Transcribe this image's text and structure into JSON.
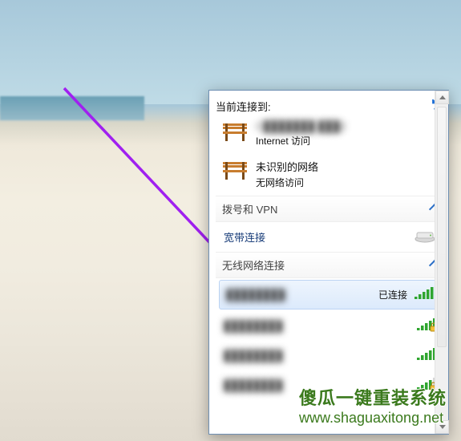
{
  "header": {
    "title": "当前连接到:"
  },
  "connections": [
    {
      "name": "C███████ ███2",
      "sub": "Internet 访问",
      "blurred": true
    },
    {
      "name": "未识别的网络",
      "sub": "无网络访问",
      "blurred": false
    }
  ],
  "sections": {
    "dialup": {
      "label": "拨号和 VPN",
      "items": [
        {
          "label": "宽带连接"
        }
      ]
    },
    "wireless": {
      "label": "无线网络连接",
      "items": [
        {
          "label": "████████",
          "status": "已连接",
          "bars": 5,
          "secure": false,
          "selected": true
        },
        {
          "label": "████████",
          "status": "",
          "bars": 5,
          "secure": true,
          "selected": false
        },
        {
          "label": "████████",
          "status": "",
          "bars": 5,
          "secure": false,
          "selected": false
        },
        {
          "label": "████████",
          "status": "",
          "bars": 4,
          "secure": true,
          "selected": false
        }
      ]
    }
  },
  "watermark": {
    "title": "傻瓜一键重装系统",
    "url": "www.shaguaxitong.net"
  },
  "colors": {
    "link": "#1a3e7a",
    "accent": "#2a6ec7",
    "wifi": "#2fa52f",
    "arrow": "#a020f0"
  }
}
